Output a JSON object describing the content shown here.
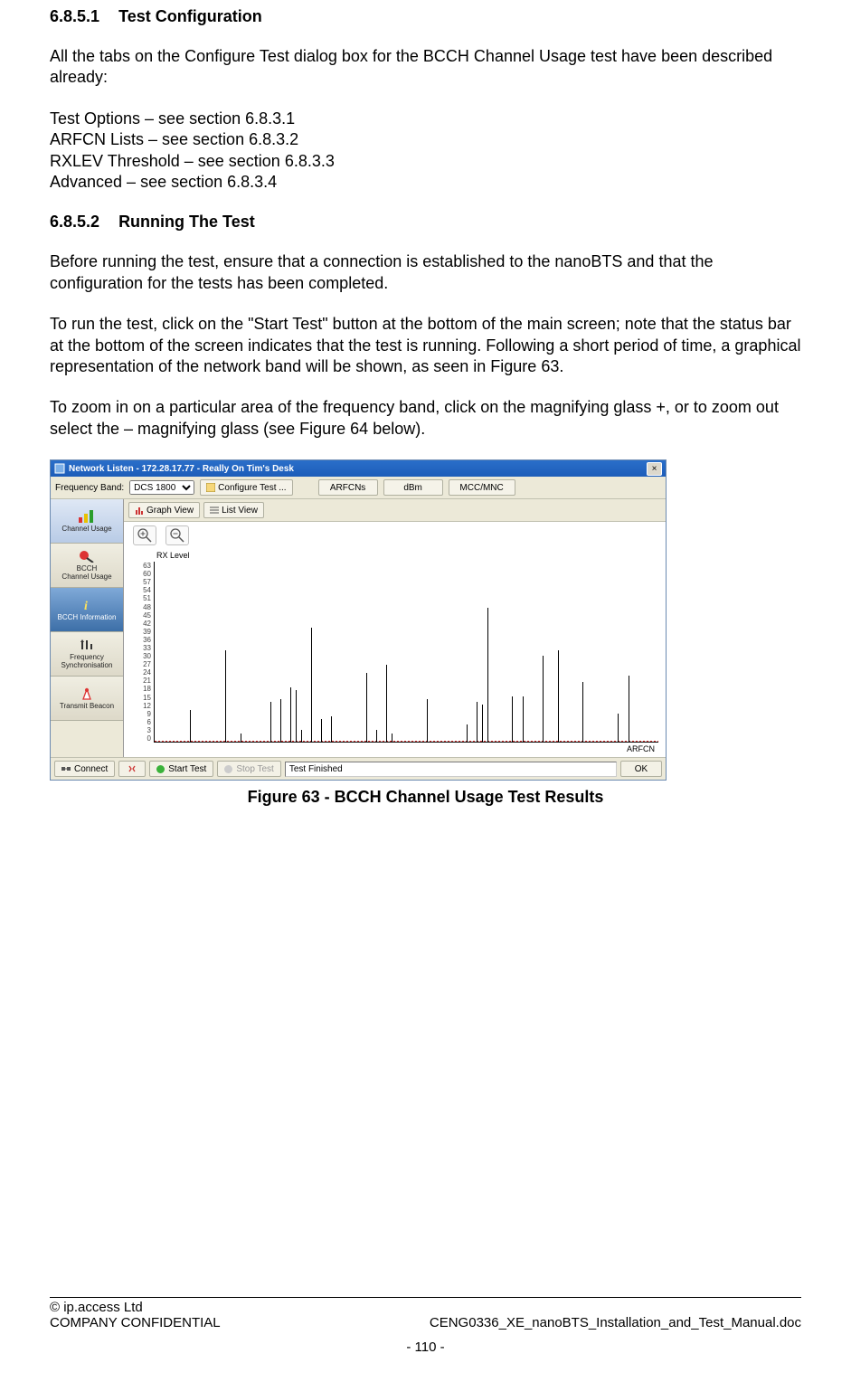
{
  "section1": {
    "number": "6.8.5.1",
    "title": "Test Configuration"
  },
  "p1": "All the tabs on the Configure Test dialog box for the BCCH Channel Usage test have been described already:",
  "refs": {
    "r1": "Test Options – see section 6.8.3.1",
    "r2": "ARFCN Lists – see section 6.8.3.2",
    "r3": "RXLEV Threshold – see section 6.8.3.3",
    "r4": "Advanced – see section 6.8.3.4"
  },
  "section2": {
    "number": "6.8.5.2",
    "title": "Running The Test"
  },
  "p2": "Before running the test, ensure that a connection is established to the nanoBTS and that the configuration for the tests has been completed.",
  "p3": "To run the test, click on the \"Start Test\" button at the bottom of the main screen; note that the status bar at the bottom of the screen indicates that the test is running. Following a short period of time, a graphical representation of the network band will be shown, as seen in Figure 63.",
  "p4": "To zoom in on a particular area of the frequency band, click on the magnifying glass +, or to zoom out select the – magnifying glass (see Figure 64 below).",
  "app": {
    "title": "Network Listen - 172.28.17.77 - Really On Tim's Desk",
    "close": "×",
    "freqLabel": "Frequency Band:",
    "freqValue": "DCS 1800",
    "configure": "Configure Test ...",
    "col_arfcns": "ARFCNs",
    "col_dbm": "dBm",
    "col_mccmnc": "MCC/MNC",
    "side": {
      "s1": "Channel Usage",
      "s2a": "BCCH",
      "s2b": "Channel Usage",
      "s3": "BCCH Information",
      "s4a": "Frequency",
      "s4b": "Synchronisation",
      "s5": "Transmit Beacon"
    },
    "graphView": "Graph View",
    "listView": "List View",
    "chart": {
      "ylabel": "RX Level",
      "xlabel": "ARFCN"
    },
    "status": {
      "connect": "Connect",
      "start": "Start Test",
      "stop": "Stop Test",
      "msg": "Test Finished",
      "ok": "OK"
    }
  },
  "figureCaption": "Figure 63 -  BCCH Channel Usage Test Results",
  "footer": {
    "copyright": "© ip.access Ltd",
    "conf": "COMPANY CONFIDENTIAL",
    "doc": "CENG0336_XE_nanoBTS_Installation_and_Test_Manual.doc",
    "page": "- 110 -"
  },
  "chart_data": {
    "type": "bar",
    "ylabel": "RX Level",
    "xlabel": "ARFCN",
    "ylim": [
      0,
      63
    ],
    "yticks": [
      63,
      60,
      57,
      54,
      51,
      48,
      45,
      42,
      39,
      36,
      33,
      30,
      27,
      24,
      21,
      18,
      15,
      12,
      9,
      6,
      3,
      0
    ],
    "x_range_pct": [
      0,
      100
    ],
    "series": [
      {
        "name": "RX Level",
        "points": [
          {
            "x_pct": 7,
            "value": 11
          },
          {
            "x_pct": 14,
            "value": 32
          },
          {
            "x_pct": 17,
            "value": 3
          },
          {
            "x_pct": 23,
            "value": 14
          },
          {
            "x_pct": 25,
            "value": 15
          },
          {
            "x_pct": 27,
            "value": 19
          },
          {
            "x_pct": 28,
            "value": 18
          },
          {
            "x_pct": 29,
            "value": 4
          },
          {
            "x_pct": 31,
            "value": 40
          },
          {
            "x_pct": 33,
            "value": 8
          },
          {
            "x_pct": 35,
            "value": 9
          },
          {
            "x_pct": 42,
            "value": 24
          },
          {
            "x_pct": 44,
            "value": 4
          },
          {
            "x_pct": 46,
            "value": 27
          },
          {
            "x_pct": 47,
            "value": 3
          },
          {
            "x_pct": 54,
            "value": 15
          },
          {
            "x_pct": 62,
            "value": 6
          },
          {
            "x_pct": 64,
            "value": 14
          },
          {
            "x_pct": 65,
            "value": 13
          },
          {
            "x_pct": 66,
            "value": 47
          },
          {
            "x_pct": 71,
            "value": 16
          },
          {
            "x_pct": 73,
            "value": 16
          },
          {
            "x_pct": 77,
            "value": 30
          },
          {
            "x_pct": 80,
            "value": 32
          },
          {
            "x_pct": 85,
            "value": 21
          },
          {
            "x_pct": 92,
            "value": 10
          },
          {
            "x_pct": 94,
            "value": 23
          }
        ]
      }
    ]
  }
}
